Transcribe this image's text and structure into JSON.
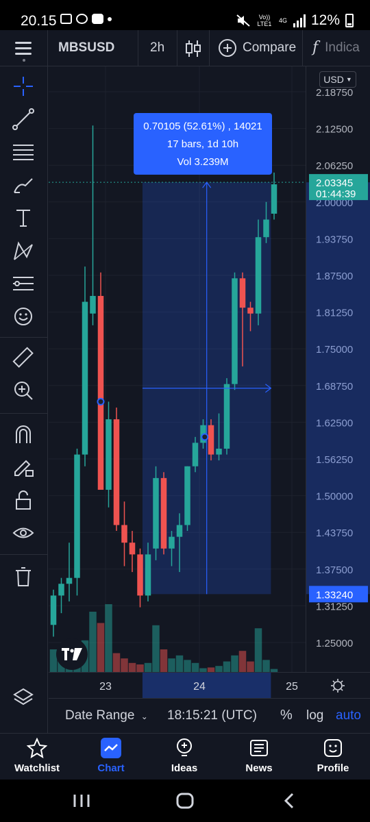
{
  "status_bar": {
    "time": "20.15",
    "volte": "Vo)) LTE1",
    "network": "4G",
    "battery": "12%"
  },
  "toolbar": {
    "symbol": "MBSUSD",
    "interval": "2h",
    "compare_label": "Compare",
    "indicators_label": "Indica"
  },
  "left_tools": [
    "crosshair-icon",
    "trend-line-icon",
    "fib-icon",
    "brush-icon",
    "text-icon",
    "pattern-icon",
    "forecast-icon",
    "emoji-icon",
    "ruler-icon",
    "zoom-icon",
    "magnet-icon",
    "lock-drawing-icon",
    "unlock-icon",
    "eye-icon",
    "trash-icon",
    "layers-icon"
  ],
  "price_axis": {
    "currency": "USD",
    "ticks": [
      "2.18750",
      "2.12500",
      "2.06250",
      "2.00000",
      "1.93750",
      "1.87500",
      "1.81250",
      "1.75000",
      "1.68750",
      "1.62500",
      "1.56250",
      "1.50000",
      "1.43750",
      "1.37500",
      "1.31250",
      "1.25000"
    ],
    "last_price": "2.03345",
    "countdown": "01:44:39",
    "range_low": "1.33240"
  },
  "measure": {
    "line1": "0.70105 (52.61%) , 14021",
    "line2": "17 bars, 1d 10h",
    "line3": "Vol 3.239M"
  },
  "time_axis": [
    "23",
    "24",
    "25"
  ],
  "bottom_strip": {
    "date_range": "Date Range",
    "clock": "18:15:21 (UTC)",
    "percent": "%",
    "log": "log",
    "auto": "auto"
  },
  "nav": {
    "watchlist": "Watchlist",
    "chart": "Chart",
    "ideas": "Ideas",
    "news": "News",
    "profile": "Profile"
  },
  "colors": {
    "up": "#26a69a",
    "down": "#ef5350",
    "accent": "#2962ff",
    "background": "#131722"
  },
  "chart_data": {
    "type": "candlestick",
    "symbol": "MBSUSD",
    "interval": "2h",
    "ylim": [
      1.2,
      2.2
    ],
    "candles": [
      {
        "o": 1.28,
        "h": 1.34,
        "l": 1.26,
        "c": 1.33
      },
      {
        "o": 1.33,
        "h": 1.36,
        "l": 1.3,
        "c": 1.35
      },
      {
        "o": 1.35,
        "h": 1.42,
        "l": 1.32,
        "c": 1.36
      },
      {
        "o": 1.36,
        "h": 1.58,
        "l": 1.33,
        "c": 1.57
      },
      {
        "o": 1.57,
        "h": 1.89,
        "l": 1.55,
        "c": 1.83
      },
      {
        "o": 1.81,
        "h": 2.13,
        "l": 1.79,
        "c": 1.84
      },
      {
        "o": 1.84,
        "h": 1.88,
        "l": 1.58,
        "c": 1.51
      },
      {
        "o": 1.51,
        "h": 1.66,
        "l": 1.48,
        "c": 1.63
      },
      {
        "o": 1.63,
        "h": 1.65,
        "l": 1.44,
        "c": 1.45
      },
      {
        "o": 1.45,
        "h": 1.49,
        "l": 1.38,
        "c": 1.42
      },
      {
        "o": 1.42,
        "h": 1.44,
        "l": 1.37,
        "c": 1.4
      },
      {
        "o": 1.4,
        "h": 1.41,
        "l": 1.31,
        "c": 1.33
      },
      {
        "o": 1.33,
        "h": 1.42,
        "l": 1.32,
        "c": 1.4
      },
      {
        "o": 1.41,
        "h": 1.55,
        "l": 1.39,
        "c": 1.53
      },
      {
        "o": 1.53,
        "h": 1.54,
        "l": 1.4,
        "c": 1.41
      },
      {
        "o": 1.41,
        "h": 1.44,
        "l": 1.38,
        "c": 1.43
      },
      {
        "o": 1.43,
        "h": 1.47,
        "l": 1.37,
        "c": 1.45
      },
      {
        "o": 1.45,
        "h": 1.55,
        "l": 1.44,
        "c": 1.55
      },
      {
        "o": 1.55,
        "h": 1.6,
        "l": 1.54,
        "c": 1.59
      },
      {
        "o": 1.59,
        "h": 1.63,
        "l": 1.58,
        "c": 1.62
      },
      {
        "o": 1.62,
        "h": 1.63,
        "l": 1.56,
        "c": 1.57
      },
      {
        "o": 1.57,
        "h": 1.64,
        "l": 1.56,
        "c": 1.58
      },
      {
        "o": 1.58,
        "h": 1.7,
        "l": 1.57,
        "c": 1.69
      },
      {
        "o": 1.69,
        "h": 1.88,
        "l": 1.68,
        "c": 1.87
      },
      {
        "o": 1.87,
        "h": 1.88,
        "l": 1.72,
        "c": 1.82
      },
      {
        "o": 1.82,
        "h": 1.83,
        "l": 1.78,
        "c": 1.81
      },
      {
        "o": 1.81,
        "h": 1.97,
        "l": 1.79,
        "c": 1.94
      },
      {
        "o": 1.94,
        "h": 2.0,
        "l": 1.93,
        "c": 1.97
      },
      {
        "o": 1.98,
        "h": 2.05,
        "l": 1.97,
        "c": 2.03
      }
    ],
    "volume": [
      0.3,
      0.18,
      0.12,
      0.28,
      0.42,
      0.8,
      0.65,
      0.9,
      0.25,
      0.18,
      0.12,
      0.1,
      0.12,
      0.62,
      0.3,
      0.18,
      0.22,
      0.16,
      0.12,
      0.05,
      0.06,
      0.08,
      0.14,
      0.22,
      0.28,
      0.14,
      0.58,
      0.16,
      0.04
    ],
    "last_price": 2.03345,
    "range_low": 1.3324
  }
}
